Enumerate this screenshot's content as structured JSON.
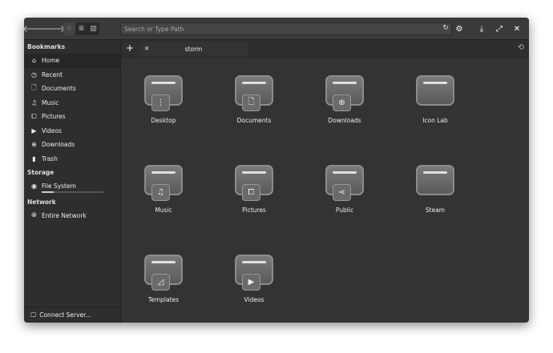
{
  "header": {
    "search_placeholder": "Search or Type Path"
  },
  "sidebar": {
    "bookmarks_title": "Bookmarks",
    "bookmarks": [
      {
        "label": "Home",
        "icon": "home-icon"
      },
      {
        "label": "Recent",
        "icon": "history-icon"
      },
      {
        "label": "Documents",
        "icon": "document-icon"
      },
      {
        "label": "Music",
        "icon": "music-icon"
      },
      {
        "label": "Pictures",
        "icon": "pictures-icon"
      },
      {
        "label": "Videos",
        "icon": "play-icon"
      },
      {
        "label": "Downloads",
        "icon": "download-icon"
      },
      {
        "label": "Trash",
        "icon": "trash-icon"
      }
    ],
    "storage_title": "Storage",
    "storage": {
      "label": "File System",
      "usage_fraction": 0.2
    },
    "network_title": "Network",
    "network": {
      "label": "Entire Network"
    },
    "connect": "Connect Server..."
  },
  "tab": {
    "label": "storm"
  },
  "folders": [
    {
      "label": "Desktop",
      "emblem": "⋮"
    },
    {
      "label": "Documents",
      "emblem": "🗋"
    },
    {
      "label": "Downloads",
      "emblem": "⊕"
    },
    {
      "label": "Icon Lab",
      "emblem": ""
    },
    {
      "label": "Music",
      "emblem": "♫"
    },
    {
      "label": "Pictures",
      "emblem": "⧠"
    },
    {
      "label": "Public",
      "emblem": "⋖"
    },
    {
      "label": "Steam",
      "emblem": ""
    },
    {
      "label": "Templates",
      "emblem": "◿"
    },
    {
      "label": "Videos",
      "emblem": "▶"
    }
  ]
}
